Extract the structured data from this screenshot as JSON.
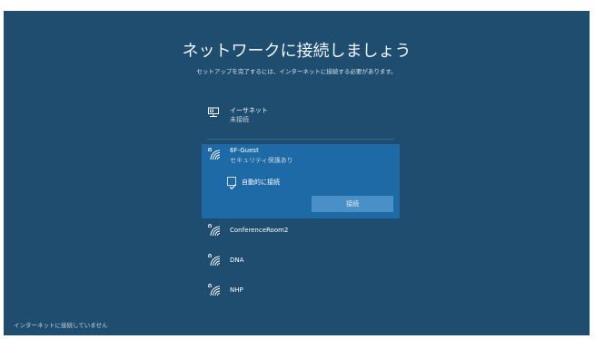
{
  "page": {
    "title": "ネットワークに接続しましょう",
    "subtitle": "セットアップを完了するには、インターネットに接続する必要があります。"
  },
  "ethernet": {
    "name": "イーサネット",
    "status": "未接続",
    "icon": "ethernet-icon"
  },
  "selected_network": {
    "name": "6F-Guest",
    "security": "セキュリティ保護あり",
    "icon": "wifi-secured-icon",
    "auto_connect_label": "自動的に接続",
    "auto_connect_checked": true,
    "connect_button_label": "接続"
  },
  "networks": [
    {
      "name": "ConferenceRoom2",
      "icon": "wifi-secured-icon"
    },
    {
      "name": "DNA",
      "icon": "wifi-secured-icon"
    },
    {
      "name": "NHP",
      "icon": "wifi-secured-icon"
    }
  ],
  "footer": {
    "status_text": "インターネットに接続していません"
  },
  "colors": {
    "background": "#1e4d70",
    "selected": "#1d6aa6",
    "button": "#4a8fc6"
  }
}
